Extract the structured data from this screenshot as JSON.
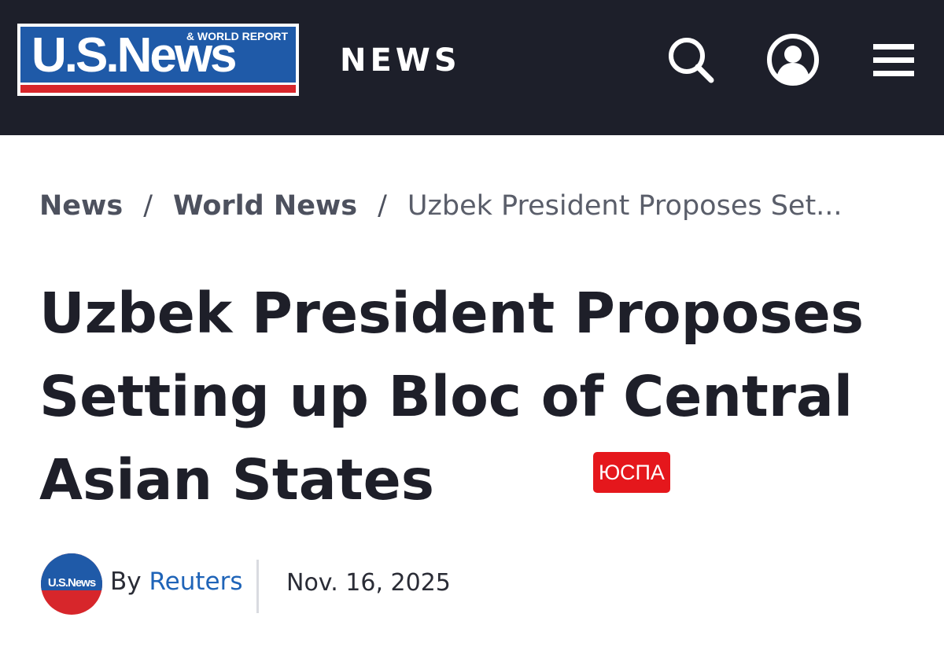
{
  "header": {
    "logo_main": "U.S.News",
    "logo_sub": "& WORLD REPORT",
    "section": "NEWS",
    "icons": [
      "search-icon",
      "account-icon",
      "menu-icon"
    ]
  },
  "breadcrumb": {
    "items": [
      "News",
      "World News"
    ],
    "separator": "/",
    "current": "Uzbek President Proposes Set..."
  },
  "article": {
    "title": "Uzbek President Proposes Setting up Bloc of Central Asian States",
    "badge": "ЮСПА",
    "byline_prefix": "By",
    "author": "Reuters",
    "avatar_text": "U.S.News",
    "date": "Nov. 16, 2025"
  },
  "colors": {
    "header_bg": "#1d1f2a",
    "brand_blue": "#1f5aa8",
    "brand_red": "#d7262b",
    "link_blue": "#1f64b8",
    "badge_red": "#e5171c"
  }
}
